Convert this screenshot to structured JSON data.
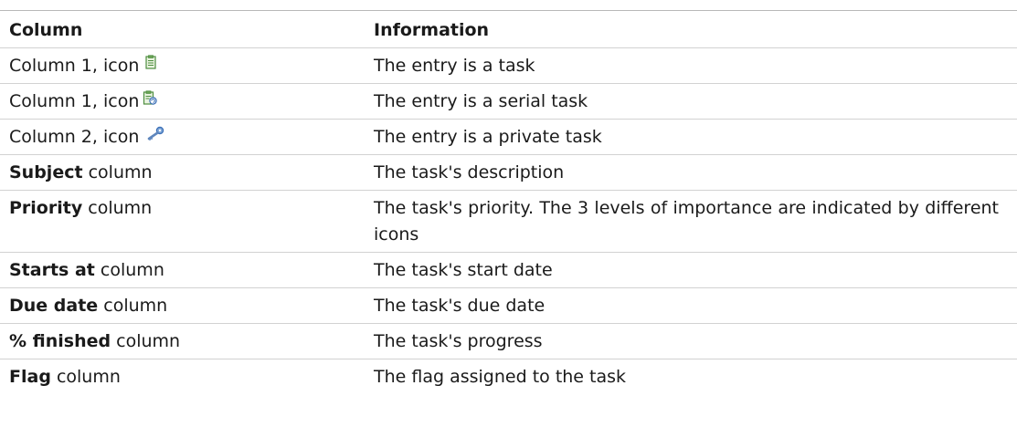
{
  "table": {
    "headers": {
      "column": "Column",
      "information": "Information"
    },
    "rows": [
      {
        "label_bold": "",
        "label_rest": "Column 1, icon",
        "icon": "task-icon",
        "info": "The entry is a task"
      },
      {
        "label_bold": "",
        "label_rest": "Column 1, icon",
        "icon": "serial-task-icon",
        "info": "The entry is a serial task"
      },
      {
        "label_bold": "",
        "label_rest": "Column 2, icon",
        "icon": "private-key-icon",
        "info": "The entry is a private task"
      },
      {
        "label_bold": "Subject",
        "label_rest": " column",
        "icon": "",
        "info": "The task's description"
      },
      {
        "label_bold": "Priority",
        "label_rest": " column",
        "icon": "",
        "info": "The task's priority. The 3 levels of importance are indicated by different icons"
      },
      {
        "label_bold": "Starts at",
        "label_rest": " column",
        "icon": "",
        "info": "The task's start date"
      },
      {
        "label_bold": "Due date",
        "label_rest": " column",
        "icon": "",
        "info": "The task's due date"
      },
      {
        "label_bold": "% finished",
        "label_rest": " column",
        "icon": "",
        "info": "The task's progress"
      },
      {
        "label_bold": "Flag",
        "label_rest": " column",
        "icon": "",
        "info": "The flag assigned to the task"
      }
    ]
  },
  "colors": {
    "text": "#1a1a1a",
    "rule": "#d2d2d2",
    "top_rule": "#b8b8b8",
    "icon_green": "#3f8f3a",
    "icon_blue": "#3b6fb6"
  }
}
